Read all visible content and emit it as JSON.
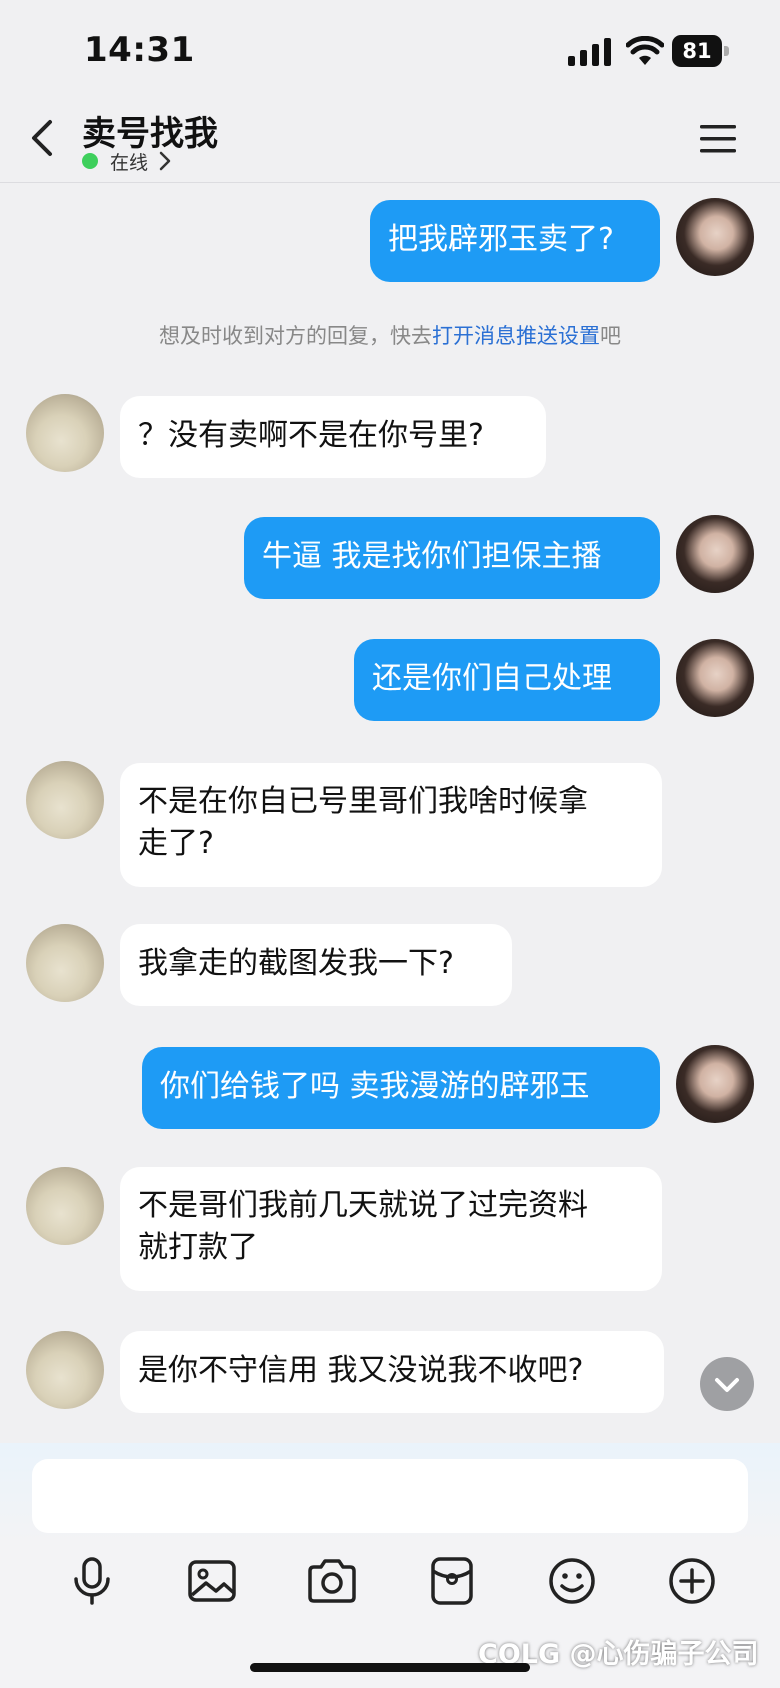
{
  "status_bar": {
    "time": "14:31",
    "battery": "81"
  },
  "header": {
    "title": "卖号找我",
    "presence": "在线"
  },
  "notice": {
    "prefix": "想及时收到对方的回复，快去",
    "link": "打开消息推送设置",
    "suffix": "吧"
  },
  "messages": [
    {
      "from": "me",
      "lines": [
        "把我辟邪玉卖了?"
      ]
    },
    {
      "from": "them",
      "lines": [
        "？没有卖啊不是在你号里?"
      ]
    },
    {
      "from": "me",
      "lines": [
        "牛逼 我是找你们担保主播"
      ]
    },
    {
      "from": "me",
      "lines": [
        "还是你们自己处理"
      ]
    },
    {
      "from": "them",
      "lines": [
        "不是在你自已号里哥们我啥时候拿",
        "走了?"
      ]
    },
    {
      "from": "them",
      "lines": [
        "我拿走的截图发我一下?"
      ]
    },
    {
      "from": "me",
      "lines": [
        "你们给钱了吗 卖我漫游的辟邪玉"
      ]
    },
    {
      "from": "them",
      "lines": [
        "不是哥们我前几天就说了过完资料",
        "就打款了"
      ]
    },
    {
      "from": "them",
      "lines": [
        "是你不守信用  我又没说我不收吧?"
      ]
    }
  ],
  "input": {
    "placeholder": ""
  },
  "toolbar": {
    "icons": [
      "microphone-icon",
      "image-icon",
      "camera-icon",
      "red-packet-icon",
      "emoji-icon",
      "plus-icon"
    ]
  },
  "watermark": "COLG @心伤骗子公司",
  "colors": {
    "accent": "#1e9bf5",
    "online": "#3ecf5c",
    "link": "#2b70d4"
  }
}
